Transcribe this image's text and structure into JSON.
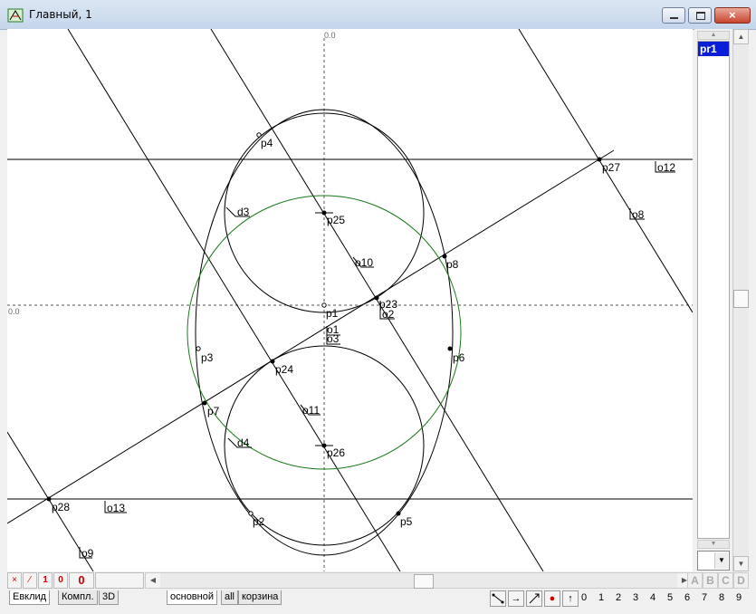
{
  "window": {
    "title": "Главный, 1"
  },
  "axes": {
    "x_origin_label": "0.0",
    "y_origin_label": "0.0"
  },
  "geometry_labels": {
    "p1": "p1",
    "p2": "p2",
    "p3": "p3",
    "p4": "p4",
    "p5": "p5",
    "p6": "p6",
    "p7": "p7",
    "p8": "p8",
    "p23": "p23",
    "p24": "p24",
    "p25": "p25",
    "p26": "p26",
    "p27": "p27",
    "p28": "p28",
    "o1": "o1",
    "o2": "o2",
    "o3": "o3",
    "o8": "o8",
    "o9": "o9",
    "o10": "o10",
    "o11": "o11",
    "o12": "o12",
    "o13": "o13",
    "d3": "d3",
    "d4": "d4"
  },
  "side_panel": {
    "layers": [
      "pr1"
    ]
  },
  "bottom_toolbar": {
    "btn_x": "×",
    "btn_slash": "⁄",
    "btn_1": "1",
    "btn_0": "0",
    "counter": "0",
    "letters": [
      "A",
      "B",
      "C",
      "D"
    ]
  },
  "tabs_left": [
    "Евклид",
    "Компл.",
    "3D"
  ],
  "tabs_right": [
    "основной",
    "all",
    "корзина"
  ],
  "tools": {
    "record": "●",
    "up": "↑",
    "arrow": "→"
  },
  "digits": [
    "0",
    "1",
    "2",
    "3",
    "4",
    "5",
    "6",
    "7",
    "8",
    "9"
  ],
  "colors": {
    "green_circle": "#1a7a1a",
    "selected_layer": "#0a1ed8",
    "red_buttons": "#d00000"
  }
}
